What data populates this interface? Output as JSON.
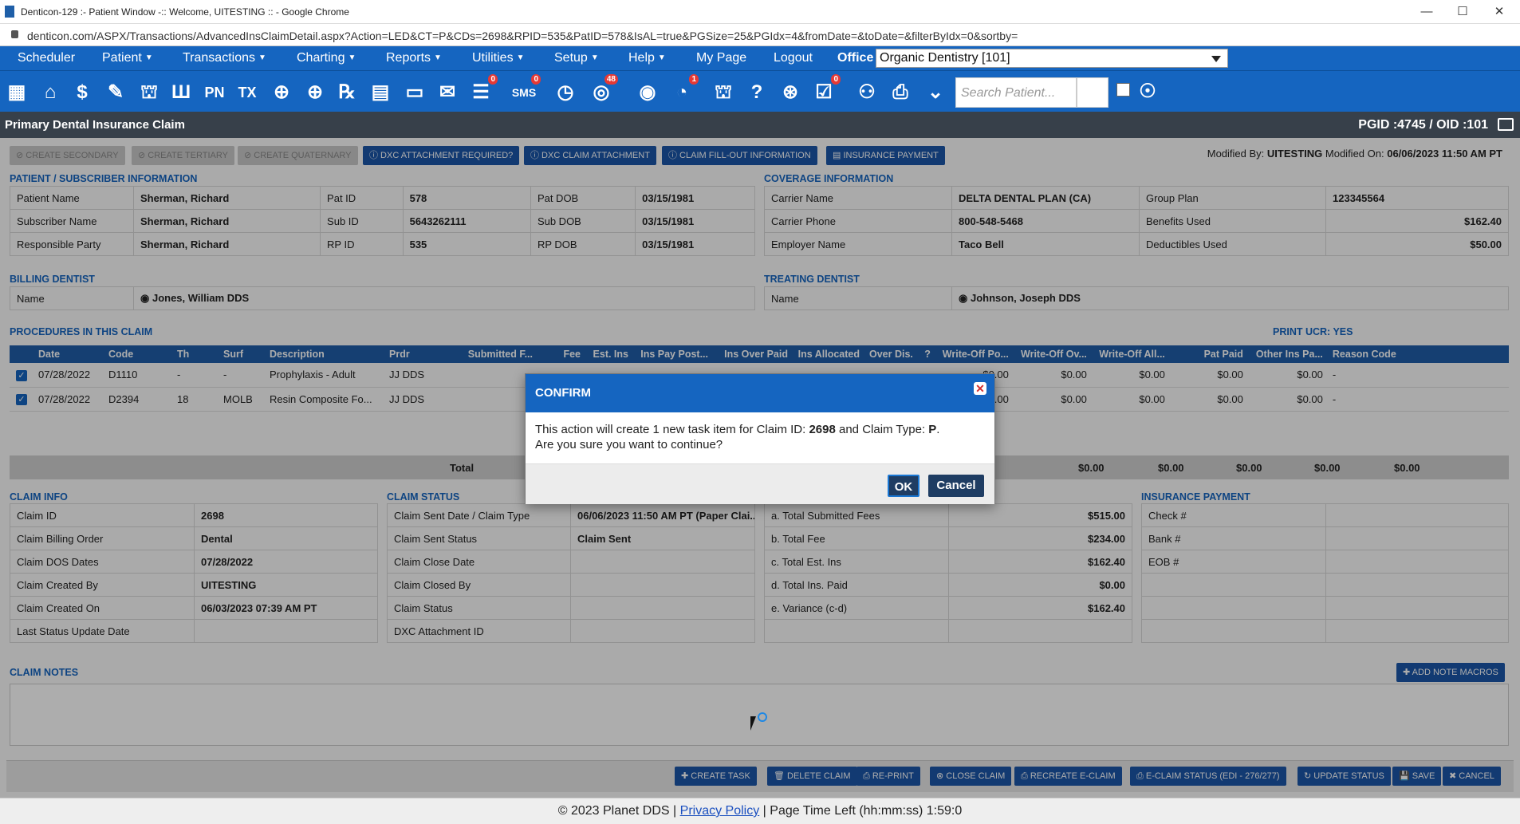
{
  "window": {
    "title": "Denticon-129 :- Patient Window -:: Welcome, UITESTING :: - Google Chrome",
    "minimize": "—",
    "maximize": "☐",
    "close": "✕"
  },
  "address": {
    "url": "denticon.com/ASPX/Transactions/AdvancedInsClaimDetail.aspx?Action=LED&CT=P&CDs=2698&RPID=535&PatID=578&IsAL=true&PGSize=25&PGIdx=4&fromDate=&toDate=&filterByIdx=0&sortby="
  },
  "menu": {
    "items": [
      "Scheduler",
      "Patient",
      "Transactions",
      "Charting",
      "Reports",
      "Utilities",
      "Setup",
      "Help",
      "My Page",
      "Logout"
    ],
    "office_label": "Office",
    "office_value": "Organic Dentistry [101]"
  },
  "toolbar": {
    "search_placeholder": "Search Patient...",
    "badges": {
      "sms": "0",
      "web": "48",
      "msg": "0",
      "alert": "1",
      "forms": "0"
    },
    "icons": [
      "calendar-icon",
      "home-icon",
      "dollar-icon",
      "pen-icon",
      "tooth-icon",
      "tooth-root-icon",
      "pn-icon",
      "tx-icon",
      "add-patient-icon",
      "add-family-icon",
      "rx-icon",
      "note-icon",
      "document-icon",
      "mail-icon",
      "chat-icon",
      "sms-icon",
      "clock-icon",
      "web-icon",
      "support-icon",
      "alert-icon",
      "tooth-chart-icon",
      "tooth-help-icon",
      "globe-icon",
      "forms-icon",
      "family-icon",
      "print-icon",
      "chevron-icon"
    ]
  },
  "page": {
    "title": "Primary Dental Insurance Claim",
    "pgid": "PGID :4745  /  OID :101"
  },
  "actions": {
    "create_secondary": "⊘ CREATE SECONDARY",
    "create_tertiary": "⊘ CREATE TERTIARY",
    "create_quaternary": "⊘ CREATE QUATERNARY",
    "dxc_required": "ⓘ DXC ATTACHMENT REQUIRED?",
    "dxc_claim": "ⓘ DXC CLAIM ATTACHMENT",
    "fillout": "ⓘ CLAIM FILL-OUT INFORMATION",
    "ins_payment": "▤ INSURANCE PAYMENT",
    "modified_by_label": "Modified By:",
    "modified_by": "UITESTING",
    "modified_on_label": "Modified On:",
    "modified_on": "06/06/2023 11:50 AM PT"
  },
  "patient": {
    "section": "PATIENT / SUBSCRIBER INFORMATION",
    "rows": [
      [
        "Patient Name",
        "Sherman, Richard",
        "Pat ID",
        "578",
        "Pat DOB",
        "03/15/1981"
      ],
      [
        "Subscriber Name",
        "Sherman, Richard",
        "Sub ID",
        "5643262111",
        "Sub DOB",
        "03/15/1981"
      ],
      [
        "Responsible Party",
        "Sherman, Richard",
        "RP ID",
        "535",
        "RP DOB",
        "03/15/1981"
      ]
    ]
  },
  "coverage": {
    "section": "COVERAGE INFORMATION",
    "rows": [
      [
        "Carrier Name",
        "DELTA DENTAL PLAN (CA)",
        "Group Plan",
        "123345564"
      ],
      [
        "Carrier Phone",
        "800-548-5468",
        "Benefits Used",
        "$162.40"
      ],
      [
        "Employer Name",
        "Taco Bell",
        "Deductibles Used",
        "$50.00"
      ]
    ]
  },
  "billing": {
    "section": "BILLING DENTIST",
    "label": "Name",
    "value": "Jones, William DDS"
  },
  "treating": {
    "section": "TREATING DENTIST",
    "label": "Name",
    "value": "Johnson, Joseph DDS"
  },
  "procedures": {
    "section": "PROCEDURES IN THIS CLAIM",
    "print_ucr": "PRINT UCR: YES",
    "headers": [
      "Date",
      "Code",
      "Th",
      "Surf",
      "Description",
      "Prdr",
      "Submitted F...",
      "Fee",
      "Est. Ins",
      "Ins Pay Post...",
      "Ins Over Paid",
      "Ins Allocated",
      "Over Dis.",
      "?",
      "Write-Off Po...",
      "Write-Off Ov...",
      "Write-Off All...",
      "Pat Paid",
      "Other Ins Pa...",
      "Reason Code"
    ],
    "rows": [
      [
        "07/28/2022",
        "D1110",
        "-",
        "-",
        "Prophylaxis - Adult",
        "JJ DDS",
        "",
        "",
        "",
        "",
        "",
        "",
        "",
        "",
        "$0.00",
        "$0.00",
        "$0.00",
        "$0.00",
        "$0.00",
        "-"
      ],
      [
        "07/28/2022",
        "D2394",
        "18",
        "MOLB",
        "Resin Composite Fo...",
        "JJ DDS",
        "",
        "",
        "",
        "",
        "",
        "",
        "",
        "",
        "$0.00",
        "$0.00",
        "$0.00",
        "$0.00",
        "$0.00",
        "-"
      ]
    ],
    "total_label": "Total",
    "totals": [
      "$0.00",
      "$0.00",
      "$0.00",
      "$0.00",
      "$0.00"
    ]
  },
  "claim_info": {
    "section": "CLAIM INFO",
    "rows": [
      [
        "Claim ID",
        "2698"
      ],
      [
        "Claim Billing Order",
        "Dental"
      ],
      [
        "Claim DOS Dates",
        "07/28/2022"
      ],
      [
        "Claim Created By",
        "UITESTING"
      ],
      [
        "Claim Created On",
        "06/03/2023 07:39 AM PT"
      ],
      [
        "Last Status Update Date",
        ""
      ]
    ]
  },
  "claim_status": {
    "section": "CLAIM STATUS",
    "rows": [
      [
        "Claim Sent Date / Claim Type",
        "06/06/2023 11:50 AM PT (Paper Clai..."
      ],
      [
        "Claim Sent Status",
        "Claim Sent"
      ],
      [
        "Claim Close Date",
        ""
      ],
      [
        "Claim Closed By",
        ""
      ],
      [
        "Claim Status",
        ""
      ],
      [
        "DXC Attachment ID",
        ""
      ]
    ]
  },
  "fees": {
    "rows": [
      [
        "a. Total Submitted Fees",
        "$515.00"
      ],
      [
        "b. Total Fee",
        "$234.00"
      ],
      [
        "c. Total Est. Ins",
        "$162.40"
      ],
      [
        "d. Total Ins. Paid",
        "$0.00"
      ],
      [
        "e. Variance (c-d)",
        "$162.40"
      ],
      [
        "",
        ""
      ]
    ]
  },
  "insurance_payment": {
    "section": "INSURANCE PAYMENT",
    "rows": [
      [
        "Check #",
        ""
      ],
      [
        "Bank #",
        ""
      ],
      [
        "EOB #",
        ""
      ],
      [
        "",
        ""
      ],
      [
        "",
        ""
      ],
      [
        "",
        ""
      ]
    ]
  },
  "notes": {
    "section": "CLAIM NOTES",
    "add_macros": "✚ ADD NOTE MACROS"
  },
  "footer_actions": [
    "✚ CREATE TASK",
    "🗑 DELETE CLAIM",
    "⎙ RE-PRINT",
    "⊗ CLOSE CLAIM",
    "⎙ RECREATE E-CLAIM",
    "⎙ E-CLAIM STATUS (EDI - 276/277)",
    "↻ UPDATE STATUS",
    "💾 SAVE",
    "✖ CANCEL"
  ],
  "page_footer": {
    "copyright": "© 2023 Planet DDS | ",
    "privacy": "Privacy Policy",
    "time_left": " | Page Time Left (hh:mm:ss) 1:59:0"
  },
  "dialog": {
    "title": "CONFIRM",
    "line1_pre": "This action will create 1 new task item for Claim ID: ",
    "claim_id": "2698",
    "line1_mid": " and Claim Type: ",
    "claim_type": "P",
    "line1_post": ".",
    "line2": "Are you sure you want to continue?",
    "ok": "OK",
    "cancel": "Cancel"
  }
}
